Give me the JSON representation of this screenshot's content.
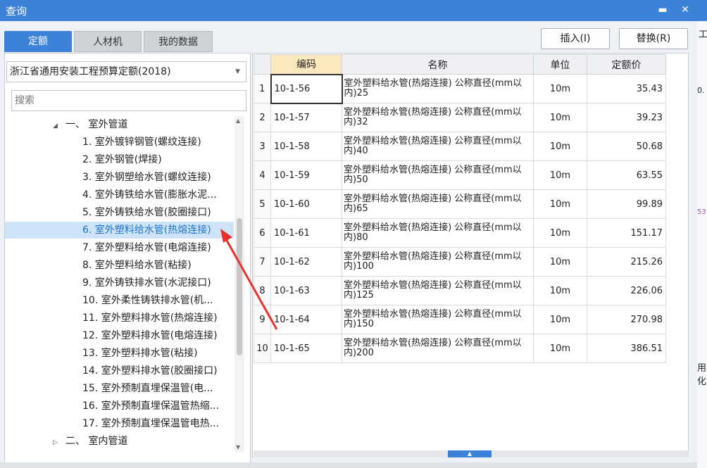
{
  "window": {
    "title": "查询"
  },
  "tabs": [
    {
      "label": "定额"
    },
    {
      "label": "人材机"
    },
    {
      "label": "我的数据"
    }
  ],
  "actions": {
    "insert": "插入(I)",
    "replace": "替换(R)"
  },
  "library": {
    "selected": "浙江省通用安装工程预算定额(2018)"
  },
  "search": {
    "placeholder": "搜索"
  },
  "tree": [
    {
      "label": "一、 室外管道",
      "level": 0,
      "expanded": true
    },
    {
      "label": "1. 室外镀锌钢管(螺纹连接)",
      "level": 1
    },
    {
      "label": "2. 室外钢管(焊接)",
      "level": 1
    },
    {
      "label": "3. 室外钢塑给水管(螺纹连接)",
      "level": 1
    },
    {
      "label": "4. 室外铸铁给水管(膨胀水泥...",
      "level": 1
    },
    {
      "label": "5. 室外铸铁给水管(胶圈接口)",
      "level": 1
    },
    {
      "label": "6. 室外塑料给水管(热熔连接)",
      "level": 1,
      "selected": true
    },
    {
      "label": "7. 室外塑料给水管(电熔连接)",
      "level": 1
    },
    {
      "label": "8. 室外塑料给水管(粘接)",
      "level": 1
    },
    {
      "label": "9. 室外铸铁排水管(水泥接口)",
      "level": 1
    },
    {
      "label": "10. 室外柔性铸铁排水管(机...",
      "level": 1
    },
    {
      "label": "11. 室外塑料排水管(热熔连接)",
      "level": 1
    },
    {
      "label": "12. 室外塑料排水管(电熔连接)",
      "level": 1
    },
    {
      "label": "13. 室外塑料排水管(粘接)",
      "level": 1
    },
    {
      "label": "14. 室外塑料排水管(胶圈接口)",
      "level": 1
    },
    {
      "label": "15. 室外预制直埋保温管(电...",
      "level": 1
    },
    {
      "label": "16. 室外预制直埋保温管热缩...",
      "level": 1
    },
    {
      "label": "17. 室外预制直埋保温管电热...",
      "level": 1
    },
    {
      "label": "二、 室内管道",
      "level": 0,
      "expanded": false
    }
  ],
  "table": {
    "columns": [
      "编码",
      "名称",
      "单位",
      "定额价"
    ],
    "rows": [
      {
        "idx": "1",
        "code": "10-1-56",
        "name": "室外塑料给水管(热熔连接) 公称直径(mm以内)25",
        "unit": "10m",
        "price": "35.43"
      },
      {
        "idx": "2",
        "code": "10-1-57",
        "name": "室外塑料给水管(热熔连接) 公称直径(mm以内)32",
        "unit": "10m",
        "price": "39.23"
      },
      {
        "idx": "3",
        "code": "10-1-58",
        "name": "室外塑料给水管(热熔连接) 公称直径(mm以内)40",
        "unit": "10m",
        "price": "50.68"
      },
      {
        "idx": "4",
        "code": "10-1-59",
        "name": "室外塑料给水管(热熔连接) 公称直径(mm以内)50",
        "unit": "10m",
        "price": "63.55"
      },
      {
        "idx": "5",
        "code": "10-1-60",
        "name": "室外塑料给水管(热熔连接) 公称直径(mm以内)65",
        "unit": "10m",
        "price": "99.89"
      },
      {
        "idx": "6",
        "code": "10-1-61",
        "name": "室外塑料给水管(热熔连接) 公称直径(mm以内)80",
        "unit": "10m",
        "price": "151.17"
      },
      {
        "idx": "7",
        "code": "10-1-62",
        "name": "室外塑料给水管(热熔连接) 公称直径(mm以内)100",
        "unit": "10m",
        "price": "215.26"
      },
      {
        "idx": "8",
        "code": "10-1-63",
        "name": "室外塑料给水管(热熔连接) 公称直径(mm以内)125",
        "unit": "10m",
        "price": "226.06"
      },
      {
        "idx": "9",
        "code": "10-1-64",
        "name": "室外塑料给水管(热熔连接) 公称直径(mm以内)150",
        "unit": "10m",
        "price": "270.98"
      },
      {
        "idx": "10",
        "code": "10-1-65",
        "name": "室外塑料给水管(热熔连接) 公称直径(mm以内)200",
        "unit": "10m",
        "price": "386.51"
      }
    ]
  },
  "right_strip": {
    "c1": "工",
    "c2": "0.",
    "c3": "53",
    "c4": "用化"
  },
  "colors": {
    "accent": "#3c82d8",
    "arrow": "#e8312c",
    "selected_bg": "#cfe3f8",
    "code_header": "#fbe9bd"
  }
}
